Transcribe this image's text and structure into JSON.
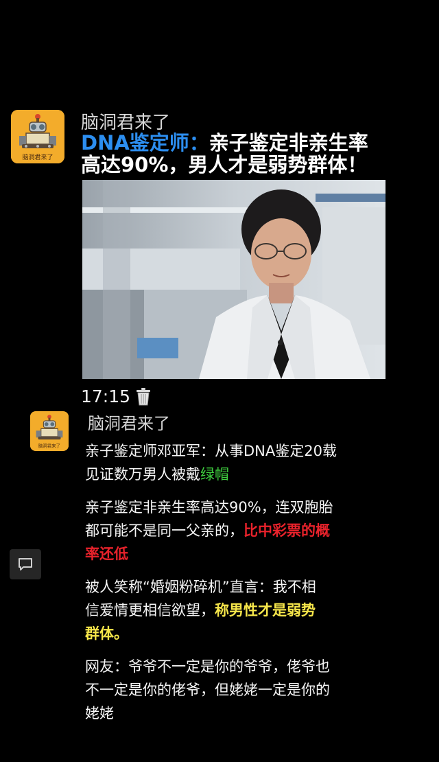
{
  "post_header": {
    "account_name": "脑洞君来了",
    "avatar_text": "脑洞君来了",
    "headline_prefix": "DNA鉴定师：",
    "headline_line1_rest": "亲子鉴定非亲生率",
    "headline_line2": "高达90%，男人才是弱势群体！"
  },
  "video": {
    "icon": "video-thumbnail"
  },
  "time": {
    "value": "17:15",
    "icon": "trash-icon"
  },
  "reply": {
    "account_name": "脑洞君来了",
    "avatar_text": "脑洞君来了",
    "p1_line1": "亲子鉴定师邓亚军：从事DNA鉴定20载",
    "p1_line2_plain": "见证数万男人被戴",
    "p1_line2_green": "绿帽",
    "p2_line1": "亲子鉴定非亲生率高达90%，连双胞胎",
    "p2_line2_plain": "都可能不是同一父亲的，",
    "p2_line2_red": "比中彩票的概",
    "p2_line3_red": "率还低",
    "p3_line1": "被人笑称“婚姻粉碎机”直言：我不相",
    "p3_line2_plain": "信爱情更相信欲望，",
    "p3_line2_yellow": "称男性才是弱势",
    "p3_line3_yellow": "群体。",
    "p4_line1": "网友：爷爷不一定是你的爷爷，佬爷也",
    "p4_line2": "不一定是你的佬爷，但姥姥一定是你的",
    "p4_line3": "姥姥"
  },
  "side": {
    "icon": "chat-bubble-icon"
  },
  "colors": {
    "avatar_bg": "#f3ac2b",
    "headline_accent": "#2c8ef0",
    "green": "#3fce3f",
    "red": "#e8222b",
    "yellow": "#f6e64a"
  }
}
